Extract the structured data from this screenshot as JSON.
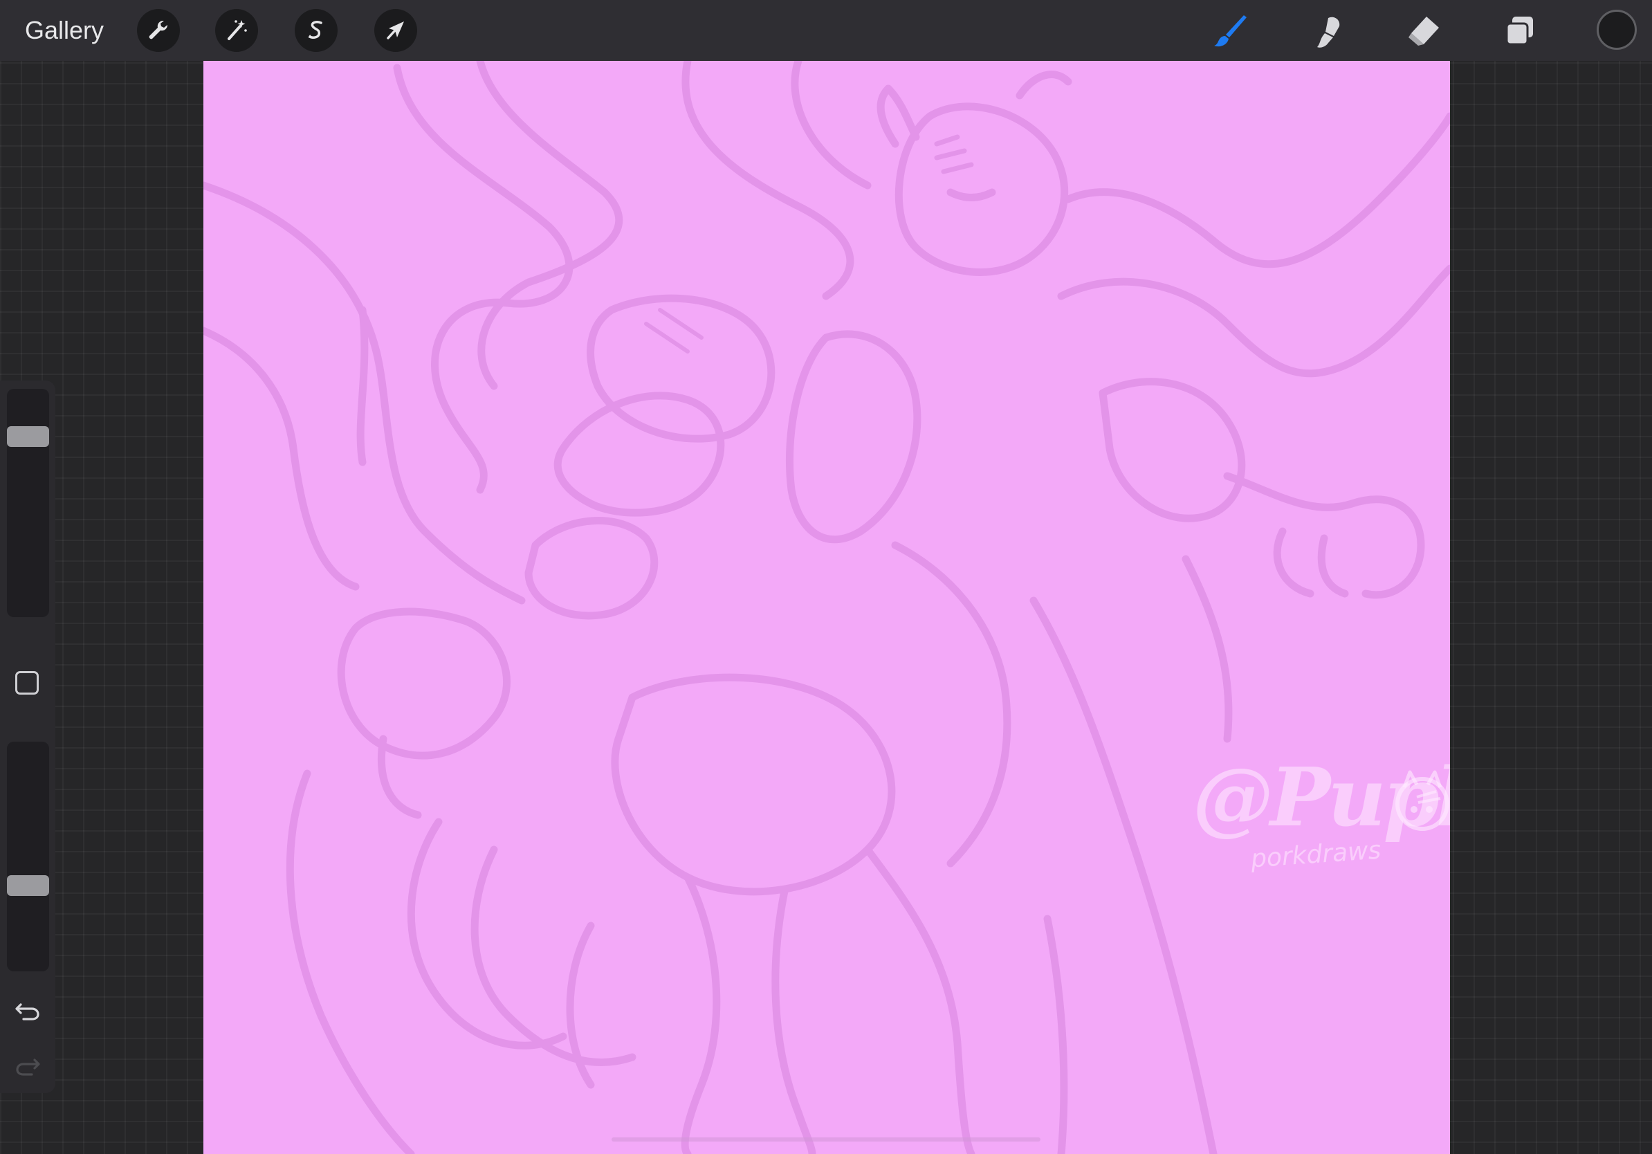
{
  "toolbar": {
    "gallery_label": "Gallery",
    "left_tools": [
      {
        "name": "wrench-icon",
        "label": "Actions"
      },
      {
        "name": "magic-wand-icon",
        "label": "Adjustments"
      },
      {
        "name": "selection-icon",
        "label": "Selection"
      },
      {
        "name": "arrow-cursor-icon",
        "label": "Transform"
      }
    ],
    "right_tools": [
      {
        "name": "brush-icon",
        "active": true
      },
      {
        "name": "smudge-icon",
        "active": false
      },
      {
        "name": "eraser-icon",
        "active": false
      },
      {
        "name": "layers-icon",
        "active": false
      }
    ],
    "current_color": "#1c1c1e",
    "active_color": "#1e7bf2"
  },
  "canvas": {
    "background_color": "#f3a9f8",
    "sketch_color": "#e08fe6",
    "watermark": {
      "line1": "@Pupbii",
      "line2": "porkdraws"
    }
  },
  "sidebar": {
    "brush_size_level": 0.82,
    "opacity_level": 0.36,
    "undo_icon": "undo-icon",
    "redo_icon": "redo-icon"
  }
}
